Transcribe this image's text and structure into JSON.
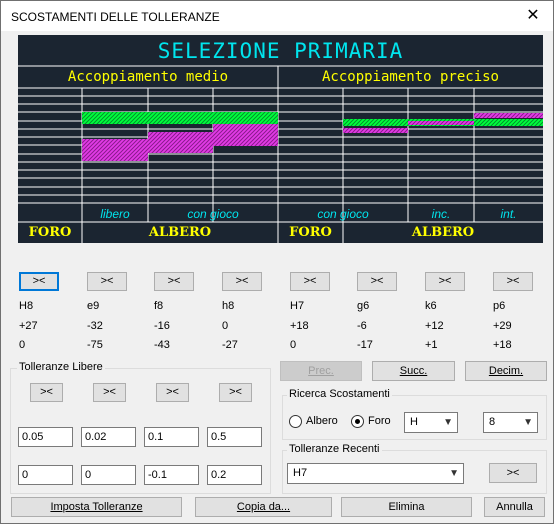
{
  "window": {
    "title": "SCOSTAMENTI DELLE TOLLERANZE",
    "close_glyph": "✕"
  },
  "diagram": {
    "heading": "SELEZIONE PRIMARIA",
    "left_title": "Accoppiamento medio",
    "right_title": "Accoppiamento preciso",
    "labels": [
      "libero",
      "con gioco",
      "con gioco",
      "inc.",
      "int."
    ],
    "bottom_labels": [
      "FORO",
      "ALBERO",
      "FORO",
      "ALBERO"
    ],
    "colors": {
      "background": "#1b2531",
      "heading": "#00e5ee",
      "title": "#ffff00",
      "label": "#00e5ee",
      "bottom": "#ffff00",
      "hole": "#00ff3c",
      "shaft": "#e23be6"
    }
  },
  "columns": [
    {
      "button": "><",
      "name": "H8",
      "upper": "+27",
      "lower": "0"
    },
    {
      "button": "><",
      "name": "e9",
      "upper": "-32",
      "lower": "-75"
    },
    {
      "button": "><",
      "name": "f8",
      "upper": "-16",
      "lower": "-43"
    },
    {
      "button": "><",
      "name": "h8",
      "upper": "0",
      "lower": "-27"
    },
    {
      "button": "><",
      "name": "H7",
      "upper": "+18",
      "lower": "0"
    },
    {
      "button": "><",
      "name": "g6",
      "upper": "-6",
      "lower": "-17"
    },
    {
      "button": "><",
      "name": "k6",
      "upper": "+12",
      "lower": "+1"
    },
    {
      "button": "><",
      "name": "p6",
      "upper": "+29",
      "lower": "+18"
    }
  ],
  "free": {
    "title": "Tolleranze Libere",
    "buttons": [
      "><",
      "><",
      "><",
      "><"
    ],
    "upper": [
      "0.05",
      "0.02",
      "0.1",
      "0.5"
    ],
    "lower": [
      "0",
      "0",
      "-0.1",
      "0.2"
    ]
  },
  "nav": {
    "prev": "Prec.",
    "next": "Succ.",
    "decim": "Decim."
  },
  "search": {
    "title": "Ricerca Scostamenti",
    "albero": "Albero",
    "foro": "Foro",
    "selected": "Foro",
    "letter": "H",
    "grade": "8"
  },
  "recent": {
    "title": "Tolleranze Recenti",
    "value": "H7",
    "button": "><"
  },
  "footer": {
    "imposta": "Imposta Tolleranze",
    "copia": "Copia da...",
    "elimina": "Elimina",
    "annulla": "Annulla"
  }
}
